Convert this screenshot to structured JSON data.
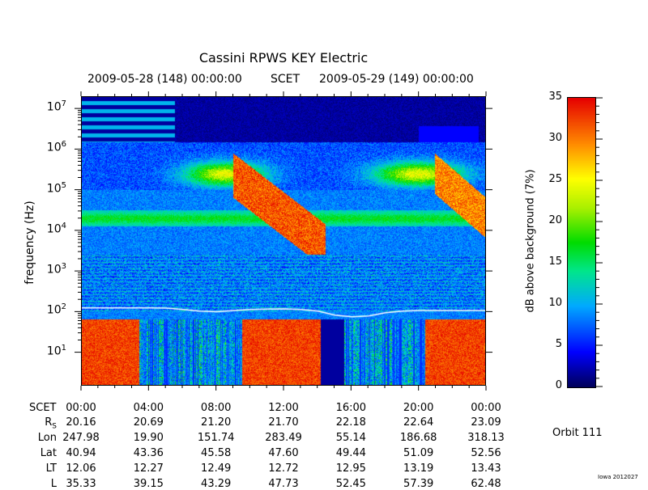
{
  "chart_data": {
    "type": "heatmap",
    "title": "Cassini RPWS KEY Electric",
    "top_labels": {
      "start": "2009-05-28 (148) 00:00:00",
      "frame": "SCET",
      "end": "2009-05-29 (149) 00:00:00"
    },
    "ylabel": "frequency (Hz)",
    "y_scale": "log",
    "ylim": [
      1.5,
      20000000
    ],
    "y_ticks": [
      {
        "base": "10",
        "exp": "7",
        "value": 10000000
      },
      {
        "base": "10",
        "exp": "6",
        "value": 1000000
      },
      {
        "base": "10",
        "exp": "5",
        "value": 100000
      },
      {
        "base": "10",
        "exp": "4",
        "value": 10000
      },
      {
        "base": "10",
        "exp": "3",
        "value": 1000
      },
      {
        "base": "10",
        "exp": "2",
        "value": 100
      },
      {
        "base": "10",
        "exp": "1",
        "value": 10
      }
    ],
    "x_range_hours": [
      0,
      24
    ],
    "x_ticks": [
      "00:00",
      "04:00",
      "08:00",
      "12:00",
      "16:00",
      "20:00",
      "00:00"
    ],
    "colorbar": {
      "label": "dB above background (7%)",
      "range": [
        0,
        35
      ],
      "ticks": [
        "35",
        "30",
        "25",
        "20",
        "15",
        "10",
        "5",
        "0"
      ]
    },
    "white_trace_hz": [
      [
        0,
        130
      ],
      [
        2,
        130
      ],
      [
        4,
        130
      ],
      [
        5,
        128
      ],
      [
        6,
        118
      ],
      [
        7,
        108
      ],
      [
        8,
        104
      ],
      [
        9,
        112
      ],
      [
        10,
        118
      ],
      [
        11,
        121
      ],
      [
        12,
        122
      ],
      [
        13,
        118
      ],
      [
        14,
        108
      ],
      [
        15,
        86
      ],
      [
        16,
        78
      ],
      [
        17,
        82
      ],
      [
        18,
        98
      ],
      [
        19,
        108
      ],
      [
        20,
        112
      ],
      [
        21,
        112
      ],
      [
        22,
        112
      ],
      [
        23,
        112
      ],
      [
        24,
        112
      ]
    ],
    "ephemeris": {
      "header_label": "SCET",
      "times": [
        "00:00",
        "04:00",
        "08:00",
        "12:00",
        "16:00",
        "20:00",
        "00:00"
      ],
      "rows": [
        {
          "label": "R",
          "sub": "S",
          "values": [
            "20.16",
            "20.69",
            "21.20",
            "21.70",
            "22.18",
            "22.64",
            "23.09"
          ]
        },
        {
          "label": "Lon",
          "sub": "",
          "values": [
            "247.98",
            "19.90",
            "151.74",
            "283.49",
            "55.14",
            "186.68",
            "318.13"
          ]
        },
        {
          "label": "Lat",
          "sub": "",
          "values": [
            "40.94",
            "43.36",
            "45.58",
            "47.60",
            "49.44",
            "51.09",
            "52.56"
          ]
        },
        {
          "label": "LT",
          "sub": "",
          "values": [
            "12.06",
            "12.27",
            "12.49",
            "12.72",
            "12.95",
            "13.19",
            "13.43"
          ]
        },
        {
          "label": "L",
          "sub": "",
          "values": [
            "35.33",
            "39.15",
            "43.29",
            "47.73",
            "52.45",
            "57.39",
            "62.48"
          ]
        }
      ]
    }
  },
  "orbit_label": "Orbit 111",
  "credit": "Iowa 2012027",
  "colors": {
    "trace": "#ffffff",
    "background": "#ffffff",
    "axis": "#000000"
  }
}
